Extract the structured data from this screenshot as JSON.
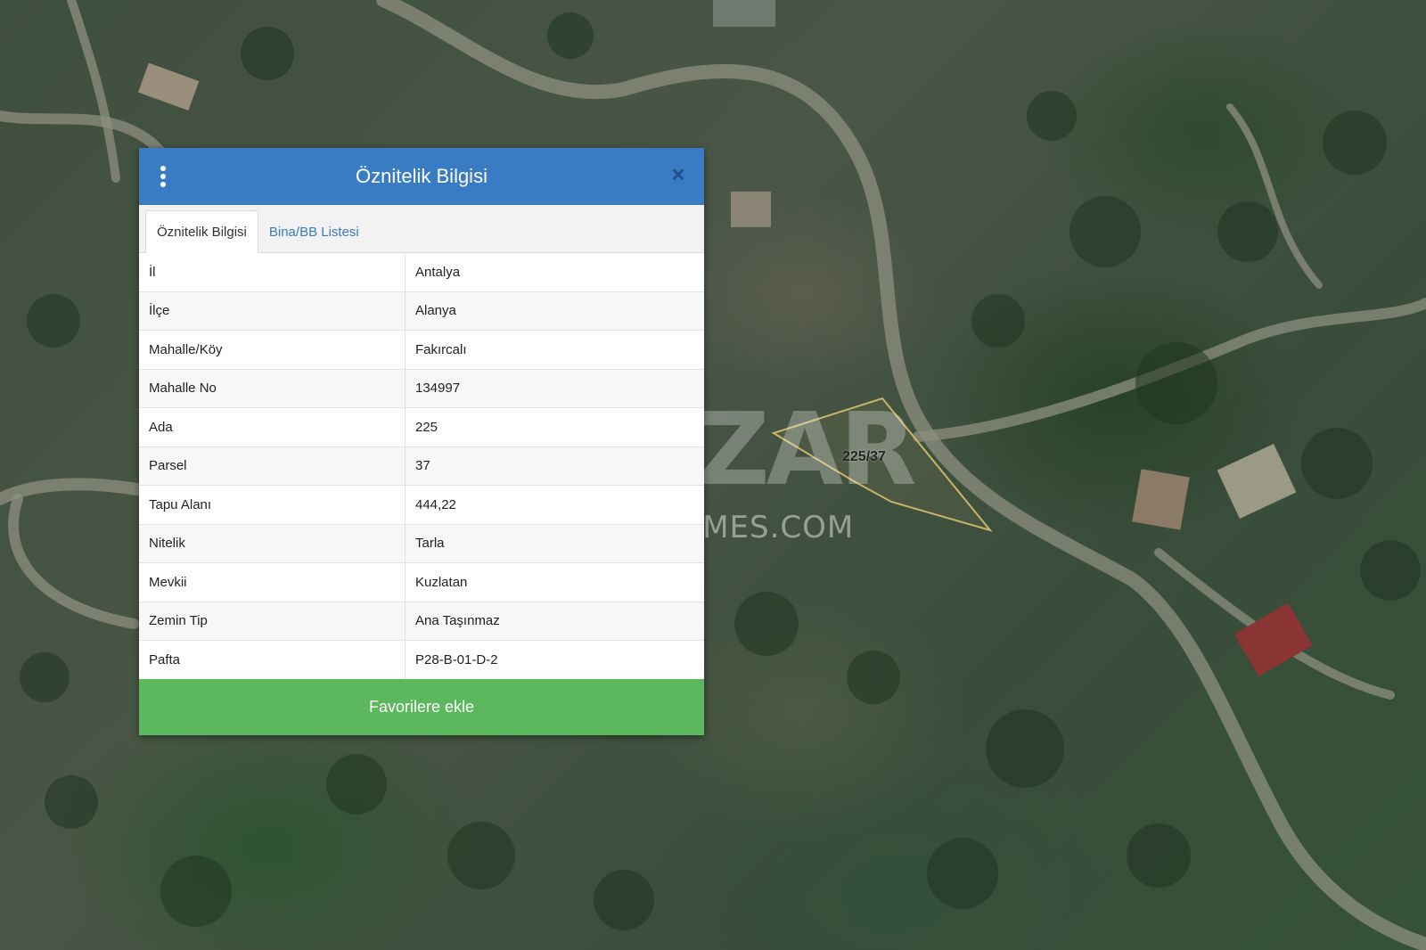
{
  "watermark": {
    "brand": "NAZAR",
    "site": "NAZARHOMES.COM"
  },
  "map": {
    "parcel_label": "225/37"
  },
  "dialog": {
    "title": "Öznitelik Bilgisi",
    "menu_icon": "kebab-menu-icon",
    "close_label": "✕",
    "tabs": [
      {
        "label": "Öznitelik Bilgisi",
        "active": true
      },
      {
        "label": "Bina/BB Listesi",
        "active": false
      }
    ],
    "rows": [
      {
        "key": "İl",
        "value": "Antalya"
      },
      {
        "key": "İlçe",
        "value": "Alanya"
      },
      {
        "key": "Mahalle/Köy",
        "value": "Fakırcalı"
      },
      {
        "key": "Mahalle No",
        "value": "134997"
      },
      {
        "key": "Ada",
        "value": "225"
      },
      {
        "key": "Parsel",
        "value": "37"
      },
      {
        "key": "Tapu Alanı",
        "value": "444,22"
      },
      {
        "key": "Nitelik",
        "value": "Tarla"
      },
      {
        "key": "Mevkii",
        "value": "Kuzlatan"
      },
      {
        "key": "Zemin Tip",
        "value": "Ana Taşınmaz"
      },
      {
        "key": "Pafta",
        "value": "P28-B-01-D-2"
      }
    ],
    "favorite_button": "Favorilere ekle"
  },
  "colors": {
    "header": "#3a7cc4",
    "favorite_button": "#5cb85c",
    "parcel_outline": "#c9b46a"
  }
}
